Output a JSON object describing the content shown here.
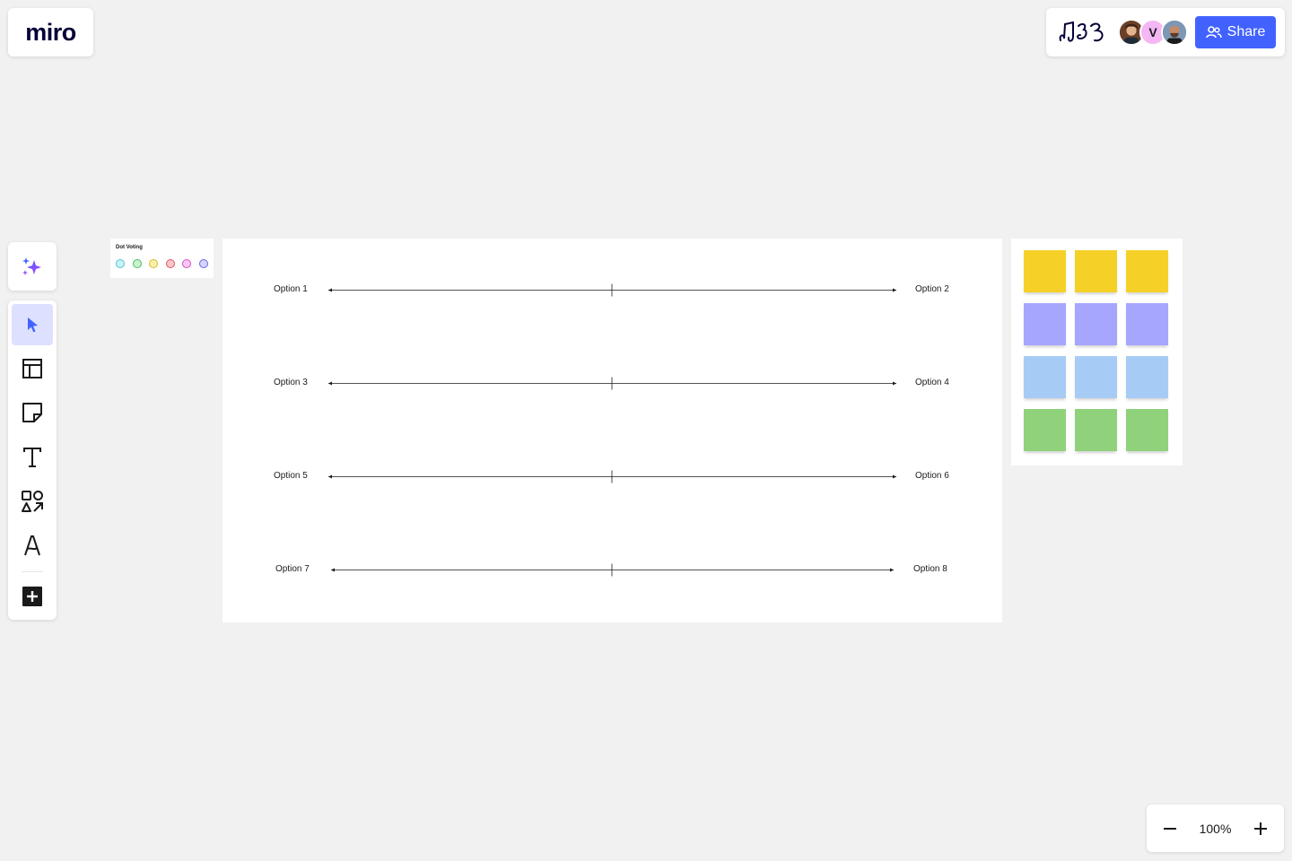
{
  "logo": {
    "text": "miro"
  },
  "topbar": {
    "avatars": [
      {
        "name": "avatar-photo-1",
        "initial": ""
      },
      {
        "name": "avatar-v",
        "initial": "V"
      },
      {
        "name": "avatar-photo-2",
        "initial": ""
      }
    ],
    "share_label": "Share",
    "accent_color": "#4262ff"
  },
  "toolbar": {
    "tools": [
      {
        "name": "select-tool",
        "icon": "cursor-icon",
        "active": true
      },
      {
        "name": "templates-tool",
        "icon": "layout-icon",
        "active": false
      },
      {
        "name": "sticky-note-tool",
        "icon": "sticky-note-icon",
        "active": false
      },
      {
        "name": "text-tool",
        "icon": "text-icon",
        "active": false
      },
      {
        "name": "shapes-tool",
        "icon": "shapes-icon",
        "active": false
      },
      {
        "name": "pen-tool",
        "icon": "pen-icon",
        "active": false
      },
      {
        "name": "more-tools",
        "icon": "plus-square-icon",
        "active": false
      }
    ]
  },
  "dot_voting": {
    "title": "Dot Voting",
    "dots": [
      {
        "fill": "#c9f2f6",
        "stroke": "#4fc3d9"
      },
      {
        "fill": "#c8f2cf",
        "stroke": "#4cbb63"
      },
      {
        "fill": "#fbf0a8",
        "stroke": "#d9b92a"
      },
      {
        "fill": "#f9c7cb",
        "stroke": "#e0565f"
      },
      {
        "fill": "#f7c8f3",
        "stroke": "#d14fc6"
      },
      {
        "fill": "#d6d4fb",
        "stroke": "#6c63e6"
      }
    ]
  },
  "spectrum": {
    "rows": [
      {
        "left": "Option 1",
        "right": "Option 2"
      },
      {
        "left": "Option 3",
        "right": "Option 4"
      },
      {
        "left": "Option 5",
        "right": "Option 6"
      },
      {
        "left": "Option 7",
        "right": "Option 8"
      }
    ]
  },
  "stickies": {
    "rows": [
      {
        "color": "#f5d128"
      },
      {
        "color": "#a6a6ff"
      },
      {
        "color": "#a6ccf5"
      },
      {
        "color": "#8fd27b"
      }
    ],
    "per_row": 3
  },
  "zoom": {
    "value": "100%"
  }
}
